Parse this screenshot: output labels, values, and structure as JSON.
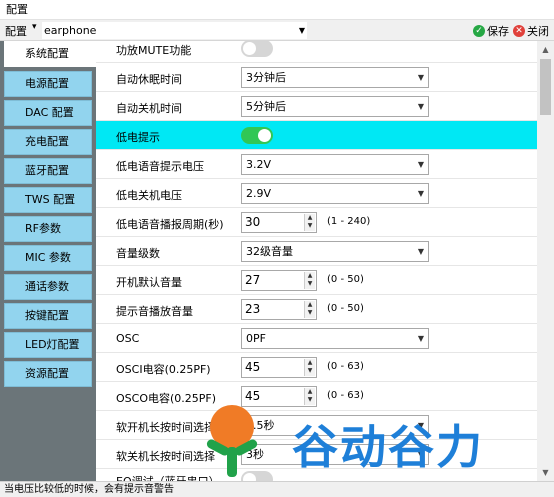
{
  "window": {
    "title": "配置"
  },
  "toolbar": {
    "label": "配置",
    "profile": "earphone",
    "save_label": "保存",
    "close_label": "关闭"
  },
  "sidebar": {
    "items": [
      {
        "label": "系统配置",
        "active": true
      },
      {
        "label": "电源配置"
      },
      {
        "label": "DAC 配置"
      },
      {
        "label": "充电配置"
      },
      {
        "label": "蓝牙配置"
      },
      {
        "label": "TWS 配置"
      },
      {
        "label": "RF参数"
      },
      {
        "label": "MIC 参数"
      },
      {
        "label": "通话参数"
      },
      {
        "label": "按键配置"
      },
      {
        "label": "LED灯配置"
      },
      {
        "label": "资源配置"
      }
    ]
  },
  "settings": [
    {
      "label": "功放MUTE功能",
      "type": "toggle",
      "on": false
    },
    {
      "label": "自动休眠时间",
      "type": "combo",
      "value": "3分钟后"
    },
    {
      "label": "自动关机时间",
      "type": "combo",
      "value": "5分钟后"
    },
    {
      "label": "低电提示",
      "type": "toggle",
      "on": true,
      "highlight": true
    },
    {
      "label": "低电语音提示电压",
      "type": "combo",
      "value": "3.2V"
    },
    {
      "label": "低电关机电压",
      "type": "combo",
      "value": "2.9V"
    },
    {
      "label": "低电语音播报周期(秒)",
      "type": "spin",
      "value": "30",
      "range": "(1 - 240)"
    },
    {
      "label": "音量级数",
      "type": "combo",
      "value": "32级音量"
    },
    {
      "label": "开机默认音量",
      "type": "spin",
      "value": "27",
      "range": "(0 - 50)"
    },
    {
      "label": "提示音播放音量",
      "type": "spin",
      "value": "23",
      "range": "(0 - 50)"
    },
    {
      "label": "OSC",
      "type": "combo",
      "value": "0PF"
    },
    {
      "label": "OSCI电容(0.25PF)",
      "type": "spin",
      "value": "45",
      "range": "(0 - 63)"
    },
    {
      "label": "OSCO电容(0.25PF)",
      "type": "spin",
      "value": "45",
      "range": "(0 - 63)"
    },
    {
      "label": "软开机长按时间选择",
      "type": "combo",
      "value": "1.5秒"
    },
    {
      "label": "软关机长按时间选择",
      "type": "combo",
      "value": "3秒"
    },
    {
      "label": "EQ调试（蓝牙串口）",
      "type": "toggle",
      "on": false
    }
  ],
  "status": {
    "text": "当电压比较低的时候，会有提示音警告"
  },
  "watermark": {
    "text": "谷动谷力"
  },
  "colors": {
    "sidebar_bg": "#6b7579",
    "sidebar_item": "#92d4ee",
    "highlight_row": "#00e8f4",
    "toggle_on": "#31c755",
    "watermark_blue": "#1e7fd8"
  }
}
